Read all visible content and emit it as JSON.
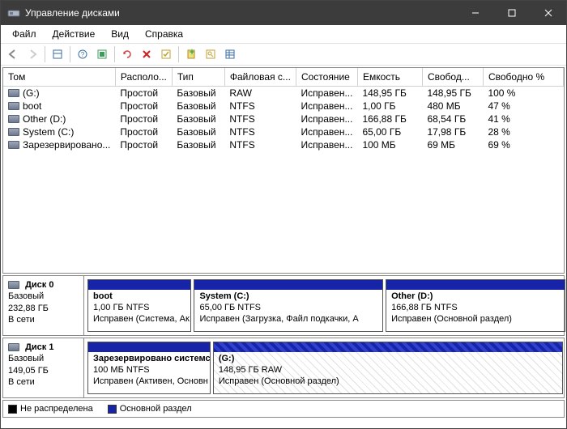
{
  "window": {
    "title": "Управление дисками"
  },
  "menu": {
    "file": "Файл",
    "action": "Действие",
    "view": "Вид",
    "help": "Справка"
  },
  "columns": {
    "vol": "Том",
    "layout": "Располо...",
    "type": "Тип",
    "fs": "Файловая с...",
    "status": "Состояние",
    "capacity": "Емкость",
    "free": "Свобод...",
    "freepct": "Свободно %"
  },
  "volumes": [
    {
      "name": "(G:)",
      "layout": "Простой",
      "type": "Базовый",
      "fs": "RAW",
      "status": "Исправен...",
      "capacity": "148,95 ГБ",
      "free": "148,95 ГБ",
      "freepct": "100 %"
    },
    {
      "name": "boot",
      "layout": "Простой",
      "type": "Базовый",
      "fs": "NTFS",
      "status": "Исправен...",
      "capacity": "1,00 ГБ",
      "free": "480 МБ",
      "freepct": "47 %"
    },
    {
      "name": "Other (D:)",
      "layout": "Простой",
      "type": "Базовый",
      "fs": "NTFS",
      "status": "Исправен...",
      "capacity": "166,88 ГБ",
      "free": "68,54 ГБ",
      "freepct": "41 %"
    },
    {
      "name": "System (C:)",
      "layout": "Простой",
      "type": "Базовый",
      "fs": "NTFS",
      "status": "Исправен...",
      "capacity": "65,00 ГБ",
      "free": "17,98 ГБ",
      "freepct": "28 %"
    },
    {
      "name": "Зарезервировано...",
      "layout": "Простой",
      "type": "Базовый",
      "fs": "NTFS",
      "status": "Исправен...",
      "capacity": "100 МБ",
      "free": "69 МБ",
      "freepct": "69 %"
    }
  ],
  "disks": [
    {
      "label": "Диск 0",
      "type": "Базовый",
      "size": "232,88 ГБ",
      "status": "В сети",
      "parts": [
        {
          "title": "boot",
          "line2": "1,00 ГБ NTFS",
          "line3": "Исправен (Система, Ак",
          "wpct": 22
        },
        {
          "title": "System  (C:)",
          "line2": "65,00 ГБ NTFS",
          "line3": "Исправен (Загрузка, Файл подкачки, А",
          "wpct": 40
        },
        {
          "title": "Other  (D:)",
          "line2": "166,88 ГБ NTFS",
          "line3": "Исправен (Основной раздел)",
          "wpct": 38
        }
      ]
    },
    {
      "label": "Диск 1",
      "type": "Базовый",
      "size": "149,05 ГБ",
      "status": "В сети",
      "parts": [
        {
          "title": "Зарезервировано системс",
          "line2": "100 МБ NTFS",
          "line3": "Исправен (Активен, Основн",
          "wpct": 26
        },
        {
          "title": "(G:)",
          "line2": "148,95 ГБ RAW",
          "line3": "Исправен (Основной раздел)",
          "wpct": 74,
          "hatch": true
        }
      ]
    }
  ],
  "legend": {
    "unalloc": "Не распределена",
    "primary": "Основной раздел"
  }
}
